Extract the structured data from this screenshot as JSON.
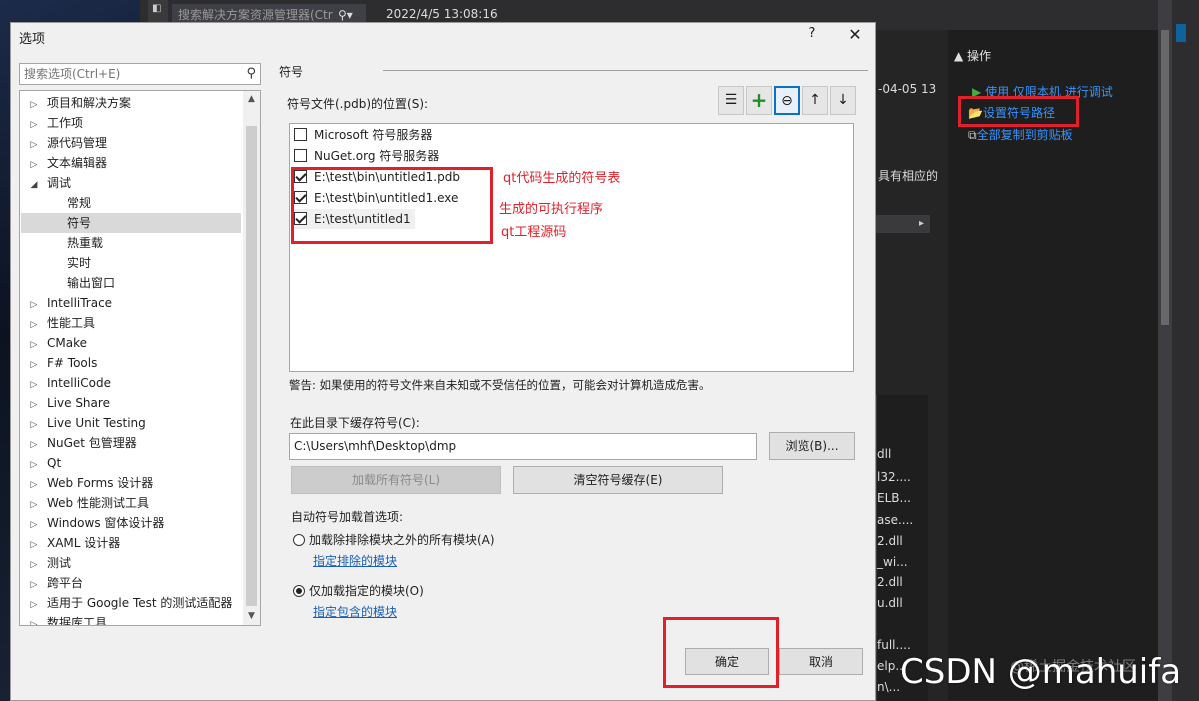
{
  "background": {
    "search_placeholder": "搜索解决方案资源管理器(Ctr",
    "datetime": "2022/4/5 13:08:16",
    "ops_title": "操作",
    "ops_links": [
      "使用 仅限本机 进行调试",
      "设置符号路径",
      "全部复制到剪贴板"
    ],
    "date_partial": "-04-05 13",
    "text_partial": "具有相应的",
    "module_list": [
      "dll",
      "l32....",
      "ELB...",
      "ase....",
      "2.dll",
      "_wi...",
      "2.dll",
      "u.dll",
      "full....",
      "elp...",
      "n\\..."
    ],
    "watermark": "CSDN @mahuifa",
    "watermark_ghost": "@稀土掘金技术社区"
  },
  "dialog": {
    "title": "选项",
    "help_label": "?",
    "close_label": "✕",
    "search_placeholder": "搜索选项(Ctrl+E)",
    "tree": [
      {
        "label": "项目和解决方案",
        "level": 0,
        "expander": "▷"
      },
      {
        "label": "工作项",
        "level": 0,
        "expander": "▷"
      },
      {
        "label": "源代码管理",
        "level": 0,
        "expander": "▷"
      },
      {
        "label": "文本编辑器",
        "level": 0,
        "expander": "▷"
      },
      {
        "label": "调试",
        "level": 0,
        "expander": "◢"
      },
      {
        "label": "常规",
        "level": 1,
        "expander": ""
      },
      {
        "label": "符号",
        "level": 1,
        "expander": "",
        "selected": true
      },
      {
        "label": "热重载",
        "level": 1,
        "expander": ""
      },
      {
        "label": "实时",
        "level": 1,
        "expander": ""
      },
      {
        "label": "输出窗口",
        "level": 1,
        "expander": ""
      },
      {
        "label": "IntelliTrace",
        "level": 0,
        "expander": "▷"
      },
      {
        "label": "性能工具",
        "level": 0,
        "expander": "▷"
      },
      {
        "label": "CMake",
        "level": 0,
        "expander": "▷"
      },
      {
        "label": "F# Tools",
        "level": 0,
        "expander": "▷"
      },
      {
        "label": "IntelliCode",
        "level": 0,
        "expander": "▷"
      },
      {
        "label": "Live Share",
        "level": 0,
        "expander": "▷"
      },
      {
        "label": "Live Unit Testing",
        "level": 0,
        "expander": "▷"
      },
      {
        "label": "NuGet 包管理器",
        "level": 0,
        "expander": "▷"
      },
      {
        "label": "Qt",
        "level": 0,
        "expander": "▷"
      },
      {
        "label": "Web Forms 设计器",
        "level": 0,
        "expander": "▷"
      },
      {
        "label": "Web 性能测试工具",
        "level": 0,
        "expander": "▷"
      },
      {
        "label": "Windows 窗体设计器",
        "level": 0,
        "expander": "▷"
      },
      {
        "label": "XAML 设计器",
        "level": 0,
        "expander": "▷"
      },
      {
        "label": "测试",
        "level": 0,
        "expander": "▷"
      },
      {
        "label": "跨平台",
        "level": 0,
        "expander": "▷"
      },
      {
        "label": "适用于 Google Test 的测试适配器",
        "level": 0,
        "expander": "▷"
      },
      {
        "label": "数据库工具",
        "level": 0,
        "expander": "▷"
      }
    ],
    "section_title": "符号",
    "locations_label": "符号文件(.pdb)的位置(S):",
    "toolbar_icons": [
      "filter-list-icon",
      "plus-icon",
      "minus-circle-icon",
      "arrow-up-icon",
      "arrow-down-icon"
    ],
    "toolbar_glyphs": [
      "☰",
      "+",
      "⊖",
      "↑",
      "↓"
    ],
    "locations": [
      {
        "label": "Microsoft 符号服务器",
        "checked": false
      },
      {
        "label": "NuGet.org 符号服务器",
        "checked": false
      },
      {
        "label": "E:\\test\\bin\\untitled1.pdb",
        "checked": true
      },
      {
        "label": "E:\\test\\bin\\untitled1.exe",
        "checked": true
      },
      {
        "label": "E:\\test\\untitled1",
        "checked": true
      }
    ],
    "annotations": [
      "qt代码生成的符号表",
      "生成的可执行程序",
      "qt工程源码"
    ],
    "warning": "警告: 如果使用的符号文件来自未知或不受信任的位置，可能会对计算机造成危害。",
    "cache_label": "在此目录下缓存符号(C):",
    "cache_value": "C:\\Users\\mhf\\Desktop\\dmp",
    "browse_button": "浏览(B)...",
    "load_all_button": "加载所有符号(L)",
    "clear_cache_button": "清空符号缓存(E)",
    "auto_load_label": "自动符号加载首选项:",
    "radio_all": "加载除排除模块之外的所有模块(A)",
    "link_excluded": "指定排除的模块",
    "radio_specified": "仅加载指定的模块(O)",
    "link_included": "指定包含的模块",
    "ok_button": "确定",
    "cancel_button": "取消",
    "annotation_color": "#e0202a",
    "link_color": "#1a5fb4"
  }
}
